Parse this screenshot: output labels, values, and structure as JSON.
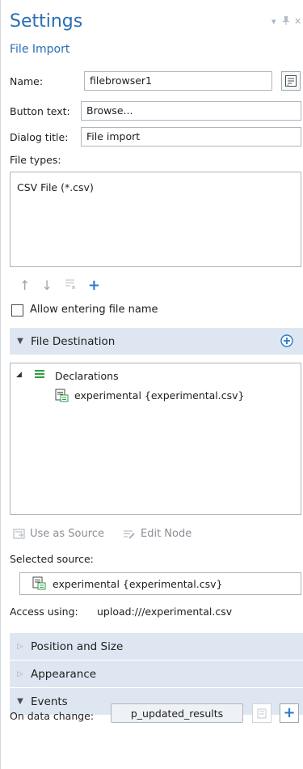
{
  "window": {
    "title": "Settings",
    "subtitle": "File Import",
    "controls": {
      "dropdown": "▾",
      "pin": "⊤",
      "close": "✕"
    }
  },
  "form": {
    "name_label": "Name:",
    "name_value": "filebrowser1",
    "button_text_label": "Button text:",
    "button_text_value": "Browse...",
    "dialog_title_label": "Dialog title:",
    "dialog_title_value": "File import",
    "file_types_label": "File types:",
    "file_types": [
      "CSV File (*.csv)"
    ],
    "allow_entering_label": "Allow entering file name",
    "allow_entering_checked": false
  },
  "file_destination": {
    "header": "File Destination",
    "tree_root": "Declarations",
    "tree_child": "experimental {experimental.csv}",
    "use_as_source": "Use as Source",
    "edit_node": "Edit Node",
    "selected_source_label": "Selected source:",
    "selected_source_value": "experimental {experimental.csv}",
    "access_label": "Access using:",
    "access_value": "upload:///experimental.csv"
  },
  "sections": {
    "position": "Position and Size",
    "appearance": "Appearance",
    "events": "Events"
  },
  "events": {
    "on_data_change_label": "On data change:",
    "on_data_change_value": "p_updated_results"
  },
  "colors": {
    "accent": "#2a6fb3",
    "section_bg": "#dee7f1",
    "plus_blue": "#2b79c9"
  }
}
